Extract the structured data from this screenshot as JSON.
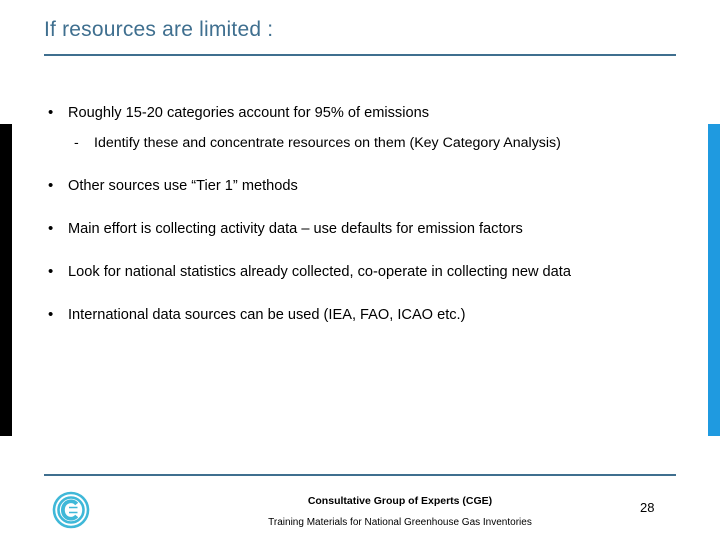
{
  "slide": {
    "title": "If resources are limited :",
    "bullets": [
      {
        "text": "Roughly 15-20 categories account for 95% of emissions",
        "sub": "Identify these and concentrate resources on them (Key Category Analysis)"
      },
      {
        "text": "Other sources use “Tier 1” methods",
        "sub": null
      },
      {
        "text": "Main effort is collecting activity data – use defaults for emission factors",
        "sub": null
      },
      {
        "text": "Look for national statistics already collected, co-operate in collecting new data",
        "sub": null
      },
      {
        "text": "International data sources can be used (IEA, FAO, ICAO etc.)",
        "sub": null
      }
    ],
    "footer": {
      "line1": "Consultative Group of Experts (CGE)",
      "line2": "Training Materials for National Greenhouse Gas Inventories",
      "page_number": "28"
    },
    "colors": {
      "title": "#3f6f8f",
      "accent_bar_right": "#1f9ae0",
      "accent_bar_left": "#000000",
      "logo": "#3fb8d8"
    }
  }
}
